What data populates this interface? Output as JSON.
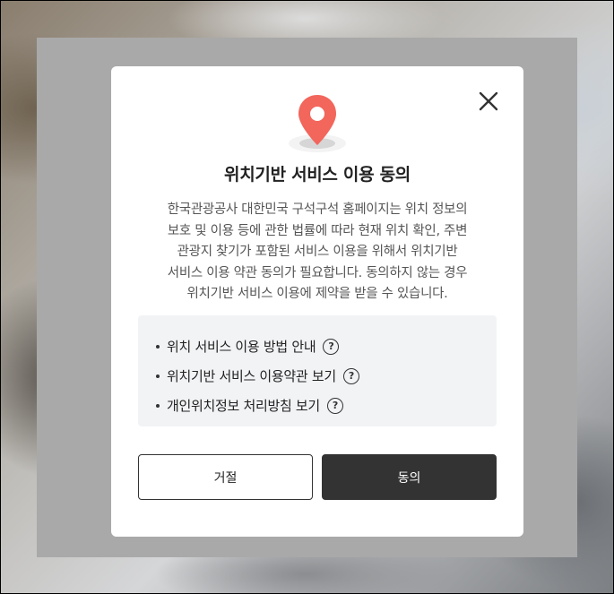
{
  "dialog": {
    "title": "위치기반 서비스 이용 동의",
    "description": [
      "한국관광공사 대한민국 구석구석 홈페이지는 위치 정보의",
      "보호 및 이용 등에 관한 법률에 따라 현재 위치 확인, 주변",
      "관광지 찾기가 포함된 서비스 이용을 위해서 위치기반",
      "서비스 이용 약관 동의가 필요합니다. 동의하지 않는 경우",
      "위치기반 서비스 이용에 제약을 받을 수 있습니다."
    ],
    "links": [
      {
        "label": "위치 서비스 이용 방법 안내",
        "help": "?"
      },
      {
        "label": "위치기반 서비스 이용약관 보기",
        "help": "?"
      },
      {
        "label": "개인위치정보 처리방침 보기",
        "help": "?"
      }
    ],
    "buttons": {
      "reject": "거절",
      "agree": "동의"
    }
  },
  "icons": {
    "close": "close-icon",
    "pin": "location-pin-icon",
    "help": "question-circle-icon"
  },
  "colors": {
    "pin": "#f2665b",
    "agree_button": "#333333",
    "link_box": "#f2f3f5",
    "backdrop": "#a9a9a9"
  }
}
